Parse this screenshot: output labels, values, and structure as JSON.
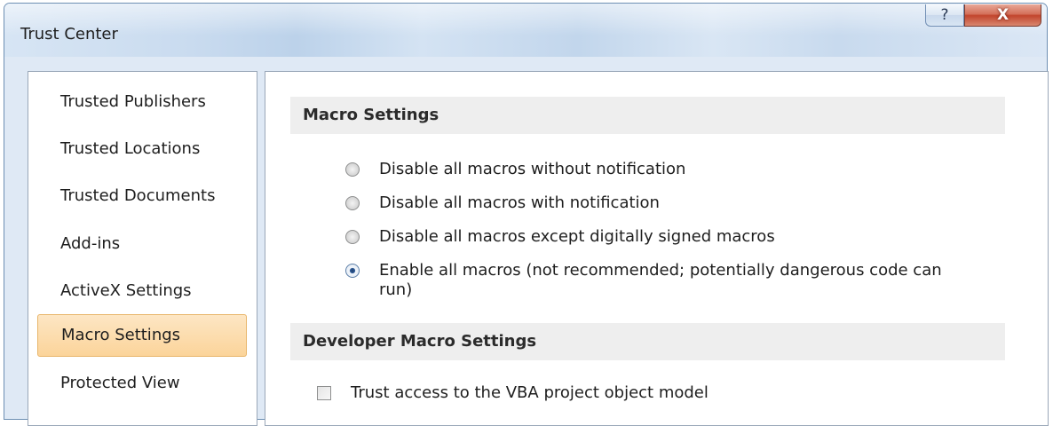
{
  "window": {
    "title": "Trust Center",
    "help_glyph": "?",
    "close_glyph": "X"
  },
  "nav": {
    "items": [
      {
        "label": "Trusted Publishers",
        "selected": false
      },
      {
        "label": "Trusted Locations",
        "selected": false
      },
      {
        "label": "Trusted Documents",
        "selected": false
      },
      {
        "label": "Add-ins",
        "selected": false
      },
      {
        "label": "ActiveX Settings",
        "selected": false
      },
      {
        "label": "Macro Settings",
        "selected": true
      },
      {
        "label": "Protected View",
        "selected": false
      }
    ]
  },
  "macro_settings": {
    "header": "Macro Settings",
    "options": [
      {
        "label": "Disable all macros without notification",
        "checked": false
      },
      {
        "label": "Disable all macros with notification",
        "checked": false
      },
      {
        "label": "Disable all macros except digitally signed macros",
        "checked": false
      },
      {
        "label_line1": "Enable all macros (not recommended; potentially dangerous code can",
        "label_line2": "run)",
        "checked": true
      }
    ]
  },
  "developer_settings": {
    "header": "Developer Macro Settings",
    "trust_vba_label": "Trust access to the VBA project object model",
    "trust_vba_checked": false
  },
  "colors": {
    "selected_nav_bg": "#fbd49a",
    "close_button": "#c2442c",
    "section_header_bg": "#eeeeee"
  }
}
